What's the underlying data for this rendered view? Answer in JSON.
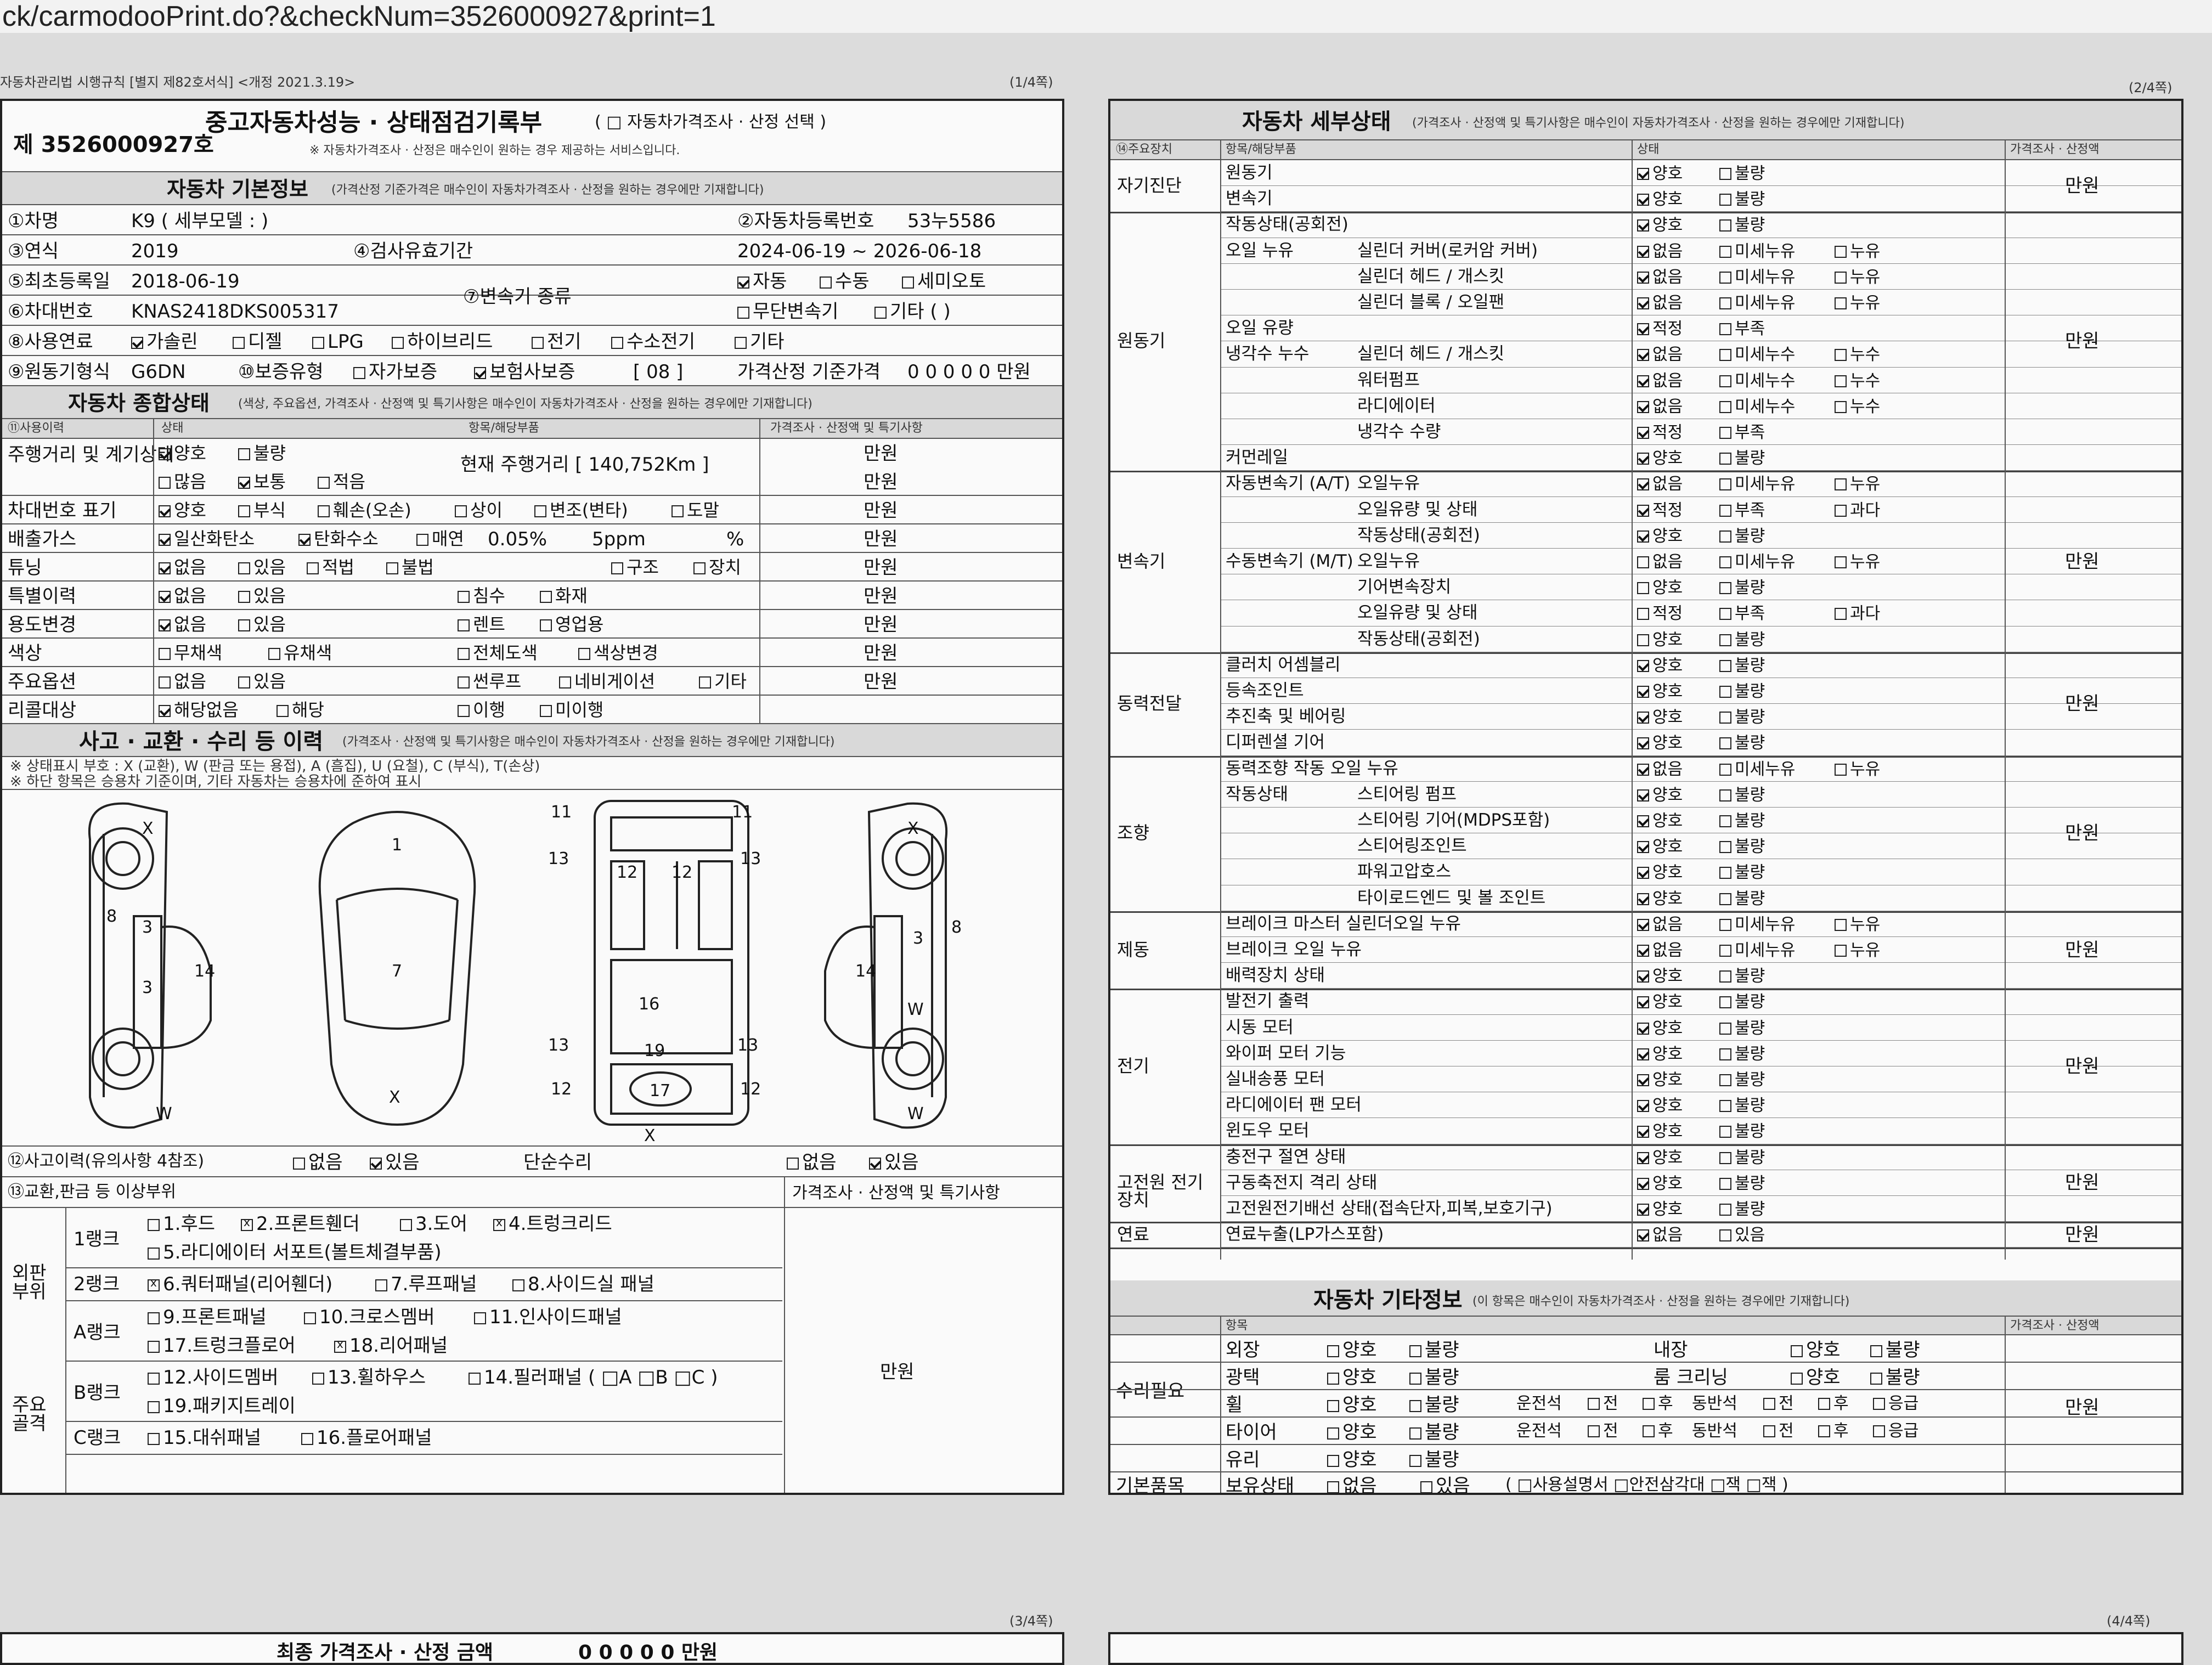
{
  "browser": {
    "url": "ck/carmodooPrint.do?&checkNum=3526000927&print=1"
  },
  "left_page": {
    "law_caption": "자동차관리법 시행규칙 [별지 제82호서식] <개정 2021.3.19>",
    "page_no": "(1/4쪽)",
    "title": "중고자동차성능 · 상태점검기록부",
    "title_option": "( □ 자동차가격조사 · 산정 선택 )",
    "title_note": "※ 자동차가격조사 · 산정은 매수인이 원하는 경우 제공하는 서비스입니다.",
    "doc_number": "제 3526000927호",
    "basic_header": "자동차 기본정보",
    "basic_header_note": "(가격산정 기준가격은 매수인이 자동차가격조사 · 산정을 원하는 경우에만 기재합니다)",
    "basic": {
      "car_name_label": "①차명",
      "car_name_value": "K9 ( 세부모델 : )",
      "reg_no_label": "②자동차등록번호",
      "reg_no_value": "53누5586",
      "year_label": "③연식",
      "year_value": "2019",
      "valid_label": "④검사유효기간",
      "valid_value": "2024-06-19 ~ 2026-06-18",
      "first_reg_label": "⑤최초등록일",
      "first_reg_value": "2018-06-19",
      "vin_label": "⑥차대번호",
      "vin_value": "KNAS2418DKS005317",
      "trans_label": "⑦변속기 종류",
      "trans_opt1": "자동",
      "trans_opt2": "수동",
      "trans_opt3": "세미오토",
      "trans_opt4": "무단변속기",
      "trans_opt5": "기타 (        )",
      "fuel_label": "⑧사용연료",
      "fuel_opts": [
        "가솔린",
        "디젤",
        "LPG",
        "하이브리드",
        "전기",
        "수소전기",
        "기타"
      ],
      "engine_label": "⑨원동기형식",
      "engine_value": "G6DN",
      "warranty_label": "⑩보증유형",
      "warranty_opt1": "자가보증",
      "warranty_opt2": "보험사보증",
      "warranty_code": "[ 08 ]",
      "price_label": "가격산정 기준가격",
      "price_value": "0 0 0 0 0 만원"
    },
    "overall_header": "자동차 종합상태",
    "overall_header_note": "(색상, 주요옵션, 가격조사 · 산정액 및 특기사항은 매수인이 자동차가격조사 · 산정을 원하는 경우에만 기재합니다)",
    "overall_cols": [
      "⑪사용이력",
      "상태",
      "항목/해당부품",
      "가격조사 · 산정액 및 특기사항"
    ],
    "overall_rows": [
      {
        "label": "주행거리 및 계기상태",
        "o1": "양호",
        "o2": "불량",
        "detail": "현재 주행거리 [ 140,752Km ]",
        "price": "만원"
      },
      {
        "label": "",
        "o1": "많음",
        "o2": "보통",
        "o3": "적음",
        "detail": "",
        "price": "만원"
      },
      {
        "label": "차대번호 표기",
        "o1": "양호",
        "o2": "부식",
        "o3": "훼손(오손)",
        "o4": "상이",
        "o5": "변조(변타)",
        "o6": "도말",
        "price": "만원"
      },
      {
        "label": "배출가스",
        "o1": "일산화탄소",
        "o2": "탄화수소",
        "o3": "매연",
        "v1": "0.05%",
        "v2": "5ppm",
        "v3": "%",
        "price": "만원"
      },
      {
        "label": "튜닝",
        "o1": "없음",
        "o2": "있음",
        "o3": "적법",
        "o4": "불법",
        "o5": "구조",
        "o6": "장치",
        "price": "만원"
      },
      {
        "label": "특별이력",
        "o1": "없음",
        "o2": "있음",
        "o3": "침수",
        "o4": "화재",
        "price": "만원"
      },
      {
        "label": "용도변경",
        "o1": "없음",
        "o2": "있음",
        "o3": "렌트",
        "o4": "영업용",
        "price": "만원"
      },
      {
        "label": "색상",
        "o1": "무채색",
        "o2": "유채색",
        "o3": "전체도색",
        "o4": "색상변경",
        "price": "만원"
      },
      {
        "label": "주요옵션",
        "o1": "없음",
        "o2": "있음",
        "o3": "썬루프",
        "o4": "네비게이션",
        "o5": "기타",
        "price": "만원"
      },
      {
        "label": "리콜대상",
        "o1": "해당없음",
        "o2": "해당",
        "o3": "이행",
        "o4": "미이행",
        "price": ""
      }
    ],
    "accident_header": "사고 · 교환 · 수리 등 이력",
    "accident_header_note": "(가격조사 · 산정액 및 특기사항은 매수인이 자동차가격조사 · 산정을 원하는 경우에만 기재합니다)",
    "legend_line1": "※ 상태표시 부호 : X (교환), W (판금 또는 용접), A (흠집), U (요철), C (부식), T(손상)",
    "legend_line2": "※ 하단 항목은 승용차 기준이며, 기타 자동차는 승용차에 준하여 표시",
    "diagram_marks": [
      "X",
      "3",
      "3",
      "W",
      "8",
      "14",
      "1",
      "7",
      "X",
      "11",
      "11",
      "13",
      "13",
      "12",
      "12",
      "16",
      "13",
      "13",
      "12",
      "12",
      "17",
      "X",
      "19",
      "X",
      "3",
      "W",
      "W",
      "8",
      "14"
    ],
    "accident_label": "⑫사고이력(유의사항 4참조)",
    "acc_opt1": "없음",
    "acc_opt2": "있음",
    "simple_repair_label": "단순수리",
    "sr_opt1": "없음",
    "sr_opt2": "있음",
    "exchange_label": "⑬교환,판금 등 이상부위",
    "exchange_price_label": "가격조사 · 산정액 및 특기사항",
    "exchange_price": "만원",
    "outer_label": "외판 부위",
    "main_label": "주요 골격",
    "rank1": "1랭크",
    "rank2": "2랭크",
    "rankA": "A랭크",
    "rankB": "B랭크",
    "rankC": "C랭크",
    "parts_r1a": "1.후드",
    "parts_r1b": "2.프론트휀더",
    "parts_r1c": "3.도어",
    "parts_r1d": "4.트렁크리드",
    "parts_r1e": "5.라디에이터 서포트(볼트체결부품)",
    "parts_r2a": "6.쿼터패널(리어휀더)",
    "parts_r2b": "7.루프패널",
    "parts_r2c": "8.사이드실 패널",
    "parts_ra1": "9.프론트패널",
    "parts_ra2": "10.크로스멤버",
    "parts_ra3": "11.인사이드패널",
    "parts_ra4": "17.트렁크플로어",
    "parts_ra5": "18.리어패널",
    "parts_rb1": "12.사이드멤버",
    "parts_rb2": "13.휠하우스",
    "parts_rb3": "14.필러패널 ( □A □B □C )",
    "parts_rb4": "19.패키지트레이",
    "parts_rc1": "15.대쉬패널",
    "parts_rc2": "16.플로어패널"
  },
  "right_page": {
    "page_no": "(2/4쪽)",
    "header": "자동차 세부상태",
    "header_note": "(가격조사 · 산정액 및 특기사항은 매수인이 자동차가격조사 · 산정을 원하는 경우에만 기재합니다)",
    "cols": [
      "⑭주요장치",
      "항목/해당부품",
      "상태",
      "가격조사 · 산정액"
    ],
    "groups": [
      {
        "name": "자기진단",
        "price": "만원",
        "rows": [
          {
            "item": "원동기",
            "sub": "",
            "state": [
              "양호",
              "불량"
            ]
          },
          {
            "item": "변속기",
            "sub": "",
            "state": [
              "양호",
              "불량"
            ]
          }
        ]
      },
      {
        "name": "원동기",
        "price": "만원",
        "rows": [
          {
            "item": "작동상태(공회전)",
            "sub": "",
            "state": [
              "양호",
              "불량"
            ]
          },
          {
            "item": "오일 누유",
            "sub": "실린더 커버(로커암 커버)",
            "state": [
              "없음",
              "미세누유",
              "누유"
            ]
          },
          {
            "item": "",
            "sub": "실린더 헤드 / 개스킷",
            "state": [
              "없음",
              "미세누유",
              "누유"
            ]
          },
          {
            "item": "",
            "sub": "실린더 블록 / 오일팬",
            "state": [
              "없음",
              "미세누유",
              "누유"
            ]
          },
          {
            "item": "오일 유량",
            "sub": "",
            "state": [
              "적정",
              "부족"
            ]
          },
          {
            "item": "냉각수 누수",
            "sub": "실린더 헤드 / 개스킷",
            "state": [
              "없음",
              "미세누수",
              "누수"
            ]
          },
          {
            "item": "",
            "sub": "워터펌프",
            "state": [
              "없음",
              "미세누수",
              "누수"
            ]
          },
          {
            "item": "",
            "sub": "라디에이터",
            "state": [
              "없음",
              "미세누수",
              "누수"
            ]
          },
          {
            "item": "",
            "sub": "냉각수 수량",
            "state": [
              "적정",
              "부족"
            ]
          },
          {
            "item": "커먼레일",
            "sub": "",
            "state": [
              "양호",
              "불량"
            ]
          }
        ]
      },
      {
        "name": "변속기",
        "price": "만원",
        "rows": [
          {
            "item": "자동변속기 (A/T)",
            "sub": "오일누유",
            "state": [
              "없음",
              "미세누유",
              "누유"
            ]
          },
          {
            "item": "",
            "sub": "오일유량 및 상태",
            "state": [
              "적정",
              "부족",
              "과다"
            ]
          },
          {
            "item": "",
            "sub": "작동상태(공회전)",
            "state": [
              "양호",
              "불량"
            ]
          },
          {
            "item": "수동변속기 (M/T)",
            "sub": "오일누유",
            "state": [
              "없음",
              "미세누유",
              "누유"
            ]
          },
          {
            "item": "",
            "sub": "기어변속장치",
            "state": [
              "양호",
              "불량"
            ]
          },
          {
            "item": "",
            "sub": "오일유량 및 상태",
            "state": [
              "적정",
              "부족",
              "과다"
            ]
          },
          {
            "item": "",
            "sub": "작동상태(공회전)",
            "state": [
              "양호",
              "불량"
            ]
          }
        ]
      },
      {
        "name": "동력전달",
        "price": "만원",
        "rows": [
          {
            "item": "클러치 어셈블리",
            "sub": "",
            "state": [
              "양호",
              "불량"
            ]
          },
          {
            "item": "등속조인트",
            "sub": "",
            "state": [
              "양호",
              "불량"
            ]
          },
          {
            "item": "추진축 및 베어링",
            "sub": "",
            "state": [
              "양호",
              "불량"
            ]
          },
          {
            "item": "디퍼렌셜 기어",
            "sub": "",
            "state": [
              "양호",
              "불량"
            ]
          }
        ]
      },
      {
        "name": "조향",
        "price": "만원",
        "rows": [
          {
            "item": "동력조향 작동 오일 누유",
            "sub": "",
            "state": [
              "없음",
              "미세누유",
              "누유"
            ]
          },
          {
            "item": "작동상태",
            "sub": "스티어링 펌프",
            "state": [
              "양호",
              "불량"
            ]
          },
          {
            "item": "",
            "sub": "스티어링 기어(MDPS포함)",
            "state": [
              "양호",
              "불량"
            ]
          },
          {
            "item": "",
            "sub": "스티어링조인트",
            "state": [
              "양호",
              "불량"
            ]
          },
          {
            "item": "",
            "sub": "파워고압호스",
            "state": [
              "양호",
              "불량"
            ]
          },
          {
            "item": "",
            "sub": "타이로드엔드 및 볼 조인트",
            "state": [
              "양호",
              "불량"
            ]
          }
        ]
      },
      {
        "name": "제동",
        "price": "만원",
        "rows": [
          {
            "item": "브레이크 마스터 실린더오일 누유",
            "sub": "",
            "state": [
              "없음",
              "미세누유",
              "누유"
            ]
          },
          {
            "item": "브레이크 오일 누유",
            "sub": "",
            "state": [
              "없음",
              "미세누유",
              "누유"
            ]
          },
          {
            "item": "배력장치 상태",
            "sub": "",
            "state": [
              "양호",
              "불량"
            ]
          }
        ]
      },
      {
        "name": "전기",
        "price": "만원",
        "rows": [
          {
            "item": "발전기 출력",
            "sub": "",
            "state": [
              "양호",
              "불량"
            ]
          },
          {
            "item": "시동 모터",
            "sub": "",
            "state": [
              "양호",
              "불량"
            ]
          },
          {
            "item": "와이퍼 모터 기능",
            "sub": "",
            "state": [
              "양호",
              "불량"
            ]
          },
          {
            "item": "실내송풍 모터",
            "sub": "",
            "state": [
              "양호",
              "불량"
            ]
          },
          {
            "item": "라디에이터 팬 모터",
            "sub": "",
            "state": [
              "양호",
              "불량"
            ]
          },
          {
            "item": "윈도우 모터",
            "sub": "",
            "state": [
              "양호",
              "불량"
            ]
          }
        ]
      },
      {
        "name": "고전원 전기장치",
        "price": "만원",
        "rows": [
          {
            "item": "충전구 절연 상태",
            "sub": "",
            "state": [
              "양호",
              "불량"
            ]
          },
          {
            "item": "구동축전지 격리 상태",
            "sub": "",
            "state": [
              "양호",
              "불량"
            ]
          },
          {
            "item": "고전원전기배선 상태(접속단자,피복,보호기구)",
            "sub": "",
            "state": [
              "양호",
              "불량"
            ]
          }
        ]
      },
      {
        "name": "연료",
        "price": "만원",
        "rows": [
          {
            "item": "연료누출(LP가스포함)",
            "sub": "",
            "state": [
              "없음",
              "있음"
            ]
          }
        ]
      }
    ],
    "other_header": "자동차 기타정보",
    "other_header_note": "(이 항목은 매수인이 자동차가격조사 · 산정을 원하는 경우에만 기재합니다)",
    "other_cols": [
      "항목",
      "가격조사 · 산정액"
    ],
    "repair_label": "수리필요",
    "repair_price": "만원",
    "exterior": "외장",
    "interior": "내장",
    "gloss": "광택",
    "room_clean": "룸 크리닝",
    "wheel": "휠",
    "tire": "타이어",
    "glass": "유리",
    "good": "양호",
    "bad": "불량",
    "driver_side": "운전석",
    "passenger_side": "동반석",
    "front": "전",
    "rear": "후",
    "emergency": "응급",
    "basic_items_label": "기본품목",
    "owned_label": "보유상태",
    "owned_opt1": "없음",
    "owned_opt2": "있음",
    "owned_detail": "( □사용설명서 □안전삼각대 □잭 □잭 )"
  },
  "bottom_pages": {
    "left_no": "(3/4쪽)",
    "right_no": "(4/4쪽)",
    "left_text": "최종 가격조사 · 산정 금액",
    "left_value": "0 0 0 0 0 만원"
  },
  "colors": {
    "checked": "#111111",
    "background": "#fafafa",
    "band": "#d9d9d9"
  }
}
